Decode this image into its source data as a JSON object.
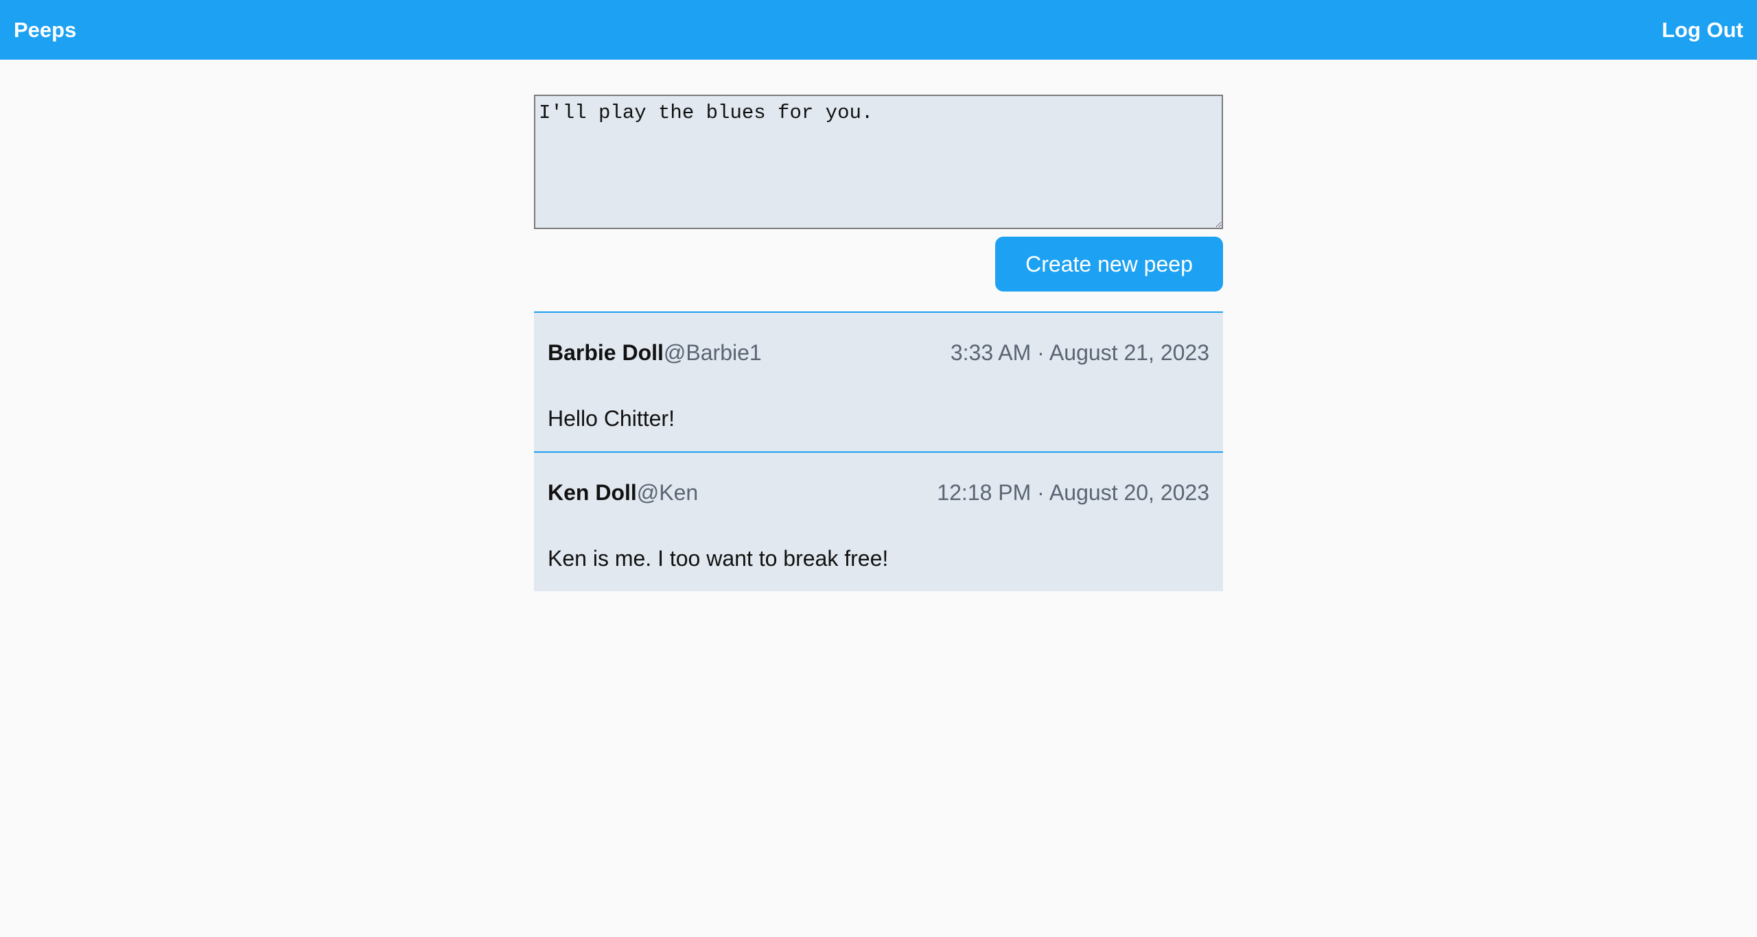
{
  "header": {
    "brand": "Peeps",
    "logout_label": "Log Out"
  },
  "composer": {
    "value": "I'll play the blues for you.",
    "button_label": "Create new peep"
  },
  "peeps": [
    {
      "name": "Barbie Doll",
      "handle": "@Barbie1",
      "time": "3:33 AM · August 21, 2023",
      "body": "Hello Chitter!"
    },
    {
      "name": "Ken Doll",
      "handle": "@Ken",
      "time": "12:18 PM · August 20, 2023",
      "body": "Ken is me. I too want to break free!"
    }
  ],
  "colors": {
    "accent": "#1da1f2",
    "card": "#e1e8ef",
    "background": "#fafafa"
  }
}
